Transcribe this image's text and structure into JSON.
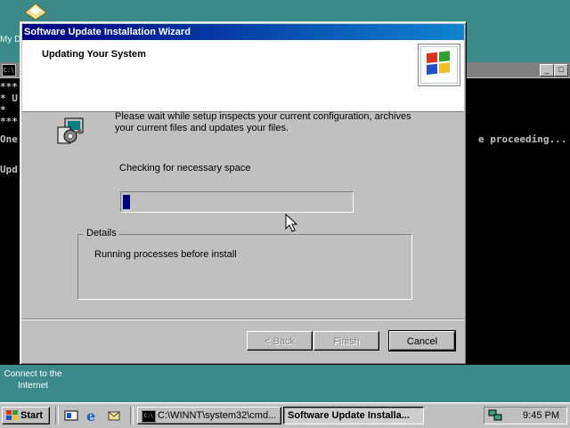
{
  "desktop": {
    "top_icon_label": "My D",
    "bottom_icon_label": "Connect to the Internet"
  },
  "console": {
    "icon_text": "C:\\",
    "lines": [
      "***",
      "* U",
      "*",
      "***",
      "One",
      "",
      "Upd"
    ],
    "right_text": "e proceeding..."
  },
  "wizard": {
    "title": "Software Update Installation Wizard",
    "header_title": "Updating Your System",
    "status_text": "Please wait while setup inspects your current configuration, archives your current files and updates your files.",
    "progress_label": "Checking for necessary space",
    "progress": 0.03,
    "details_legend": "Details",
    "details_text": "Running processes before install",
    "buttons": {
      "back": "< Back",
      "finish": "Finish",
      "cancel": "Cancel"
    }
  },
  "taskbar": {
    "start_label": "Start",
    "tasks": [
      {
        "label": "C:\\WINNT\\system32\\cmd...",
        "active": false
      },
      {
        "label": "Software Update Installa...",
        "active": true
      }
    ],
    "clock": "9:45 PM"
  },
  "colors": {
    "desktop": "#3a8a8a",
    "titlebar_active": "#000080",
    "face": "#c0c0c0",
    "progress_fill": "#000080"
  }
}
